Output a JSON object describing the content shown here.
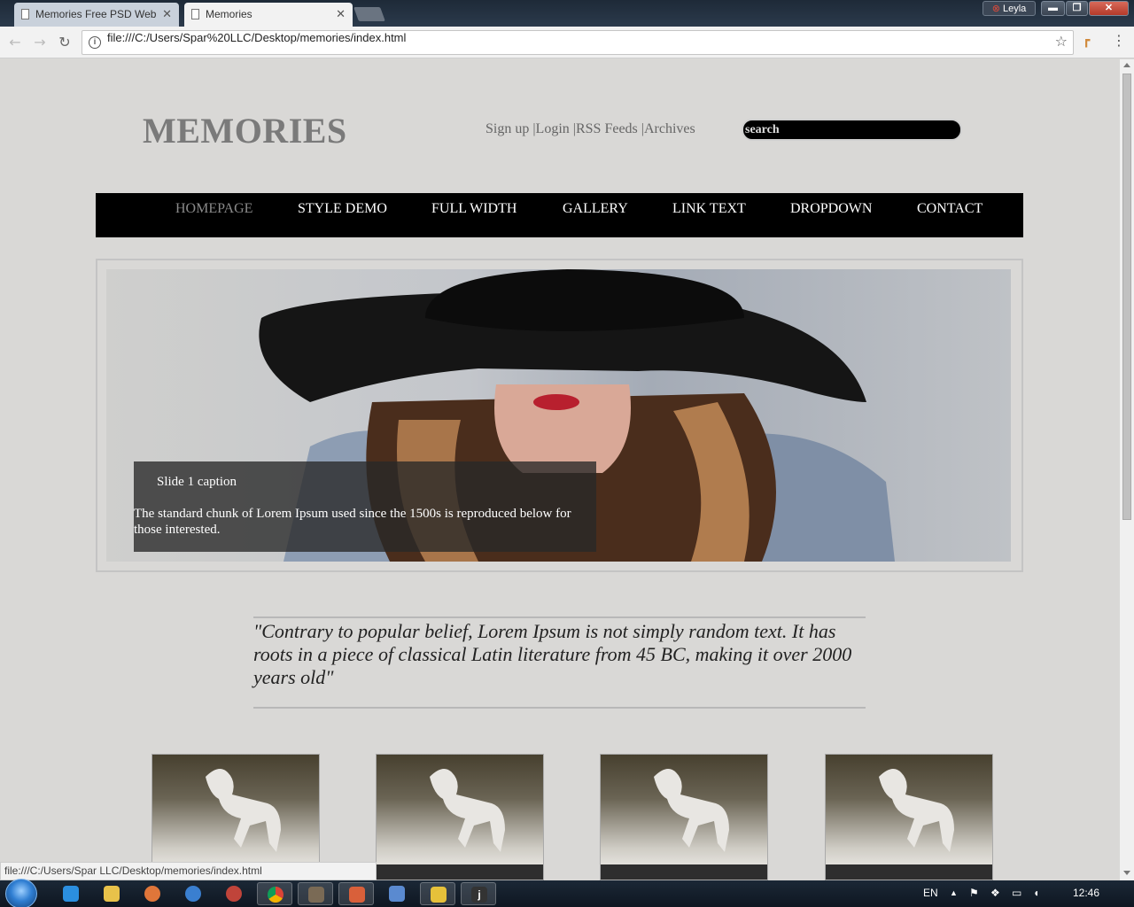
{
  "browser": {
    "tabs": [
      {
        "title": "Memories Free PSD Web"
      },
      {
        "title": "Memories"
      }
    ],
    "user": "Leyla",
    "address": "file:///C:/Users/Spar%20LLC/Desktop/memories/index.html",
    "status_url": "file:///C:/Users/Spar LLC/Desktop/memories/index.html"
  },
  "site": {
    "logo": "MEMORIES",
    "toplinks": {
      "signup": "Sign up |",
      "login": "Login |",
      "rss": "RSS Feeds |",
      "archives": "Archives"
    },
    "search_placeholder": "search",
    "nav": [
      {
        "label": "HOMEPAGE"
      },
      {
        "label": "STYLE DEMO"
      },
      {
        "label": "FULL WIDTH"
      },
      {
        "label": "GALLERY"
      },
      {
        "label": "LINK TEXT"
      },
      {
        "label": "DROPDOWN"
      },
      {
        "label": "CONTACT"
      }
    ],
    "slide": {
      "caption_title": "Slide 1 caption",
      "caption_text": "The standard chunk of Lorem Ipsum used since the 1500s is reproduced below for those interested."
    },
    "quote": "\"Contrary to popular belief, Lorem Ipsum is not simply random text. It has roots in a piece of classical Latin literature from 45 BC, making it over 2000 years old\""
  },
  "taskbar": {
    "language": "EN",
    "time": "12:46"
  }
}
